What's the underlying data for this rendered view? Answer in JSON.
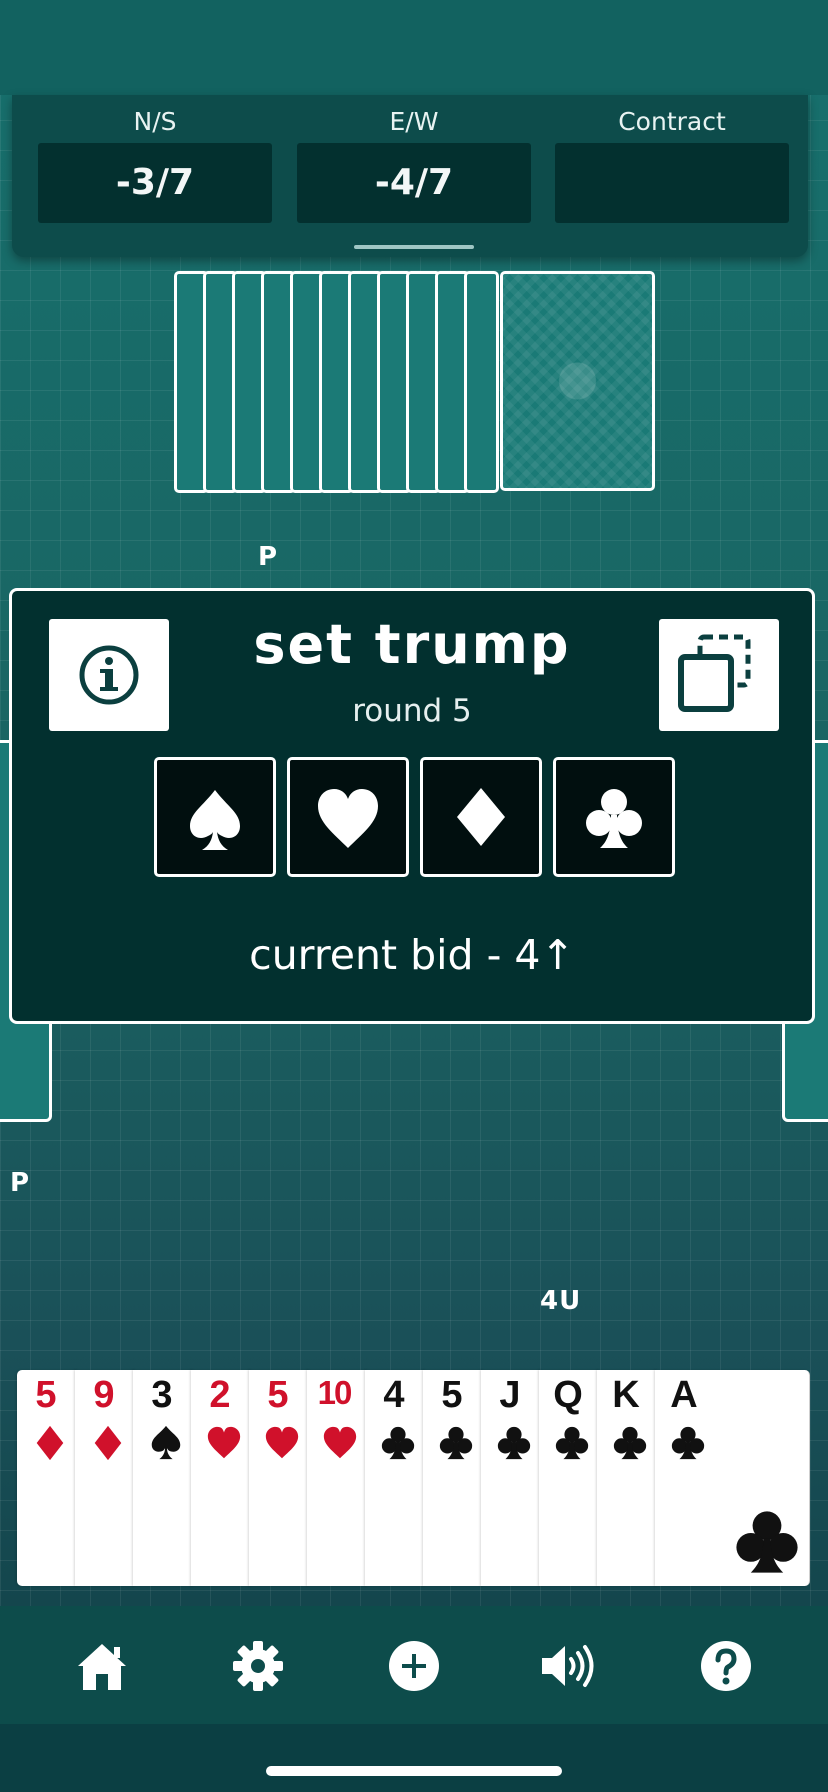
{
  "scoreboard": {
    "ns_label": "N/S",
    "ns_value": "-3/7",
    "ew_label": "E/W",
    "ew_value": "-4/7",
    "contract_label": "Contract",
    "contract_value": ""
  },
  "bid_markers": {
    "north": "P",
    "west": "P",
    "south": "4U"
  },
  "dialog": {
    "title": "set trump",
    "subtitle": "round 5",
    "current_bid": "current bid - 4↑",
    "info_icon": "info-icon",
    "copy_icon": "copy-icon",
    "suits": [
      "spade",
      "heart",
      "diamond",
      "club"
    ]
  },
  "hand": [
    {
      "rank": "5",
      "suit": "diamond",
      "color": "#d0112b"
    },
    {
      "rank": "9",
      "suit": "diamond",
      "color": "#d0112b"
    },
    {
      "rank": "3",
      "suit": "spade",
      "color": "#111111"
    },
    {
      "rank": "2",
      "suit": "heart",
      "color": "#d0112b"
    },
    {
      "rank": "5",
      "suit": "heart",
      "color": "#d0112b"
    },
    {
      "rank": "10",
      "suit": "heart",
      "color": "#d0112b"
    },
    {
      "rank": "4",
      "suit": "club",
      "color": "#111111"
    },
    {
      "rank": "5",
      "suit": "club",
      "color": "#111111"
    },
    {
      "rank": "J",
      "suit": "club",
      "color": "#111111"
    },
    {
      "rank": "Q",
      "suit": "club",
      "color": "#111111"
    },
    {
      "rank": "K",
      "suit": "club",
      "color": "#111111"
    },
    {
      "rank": "A",
      "suit": "club",
      "color": "#111111"
    }
  ],
  "nav": {
    "items": [
      "home-icon",
      "settings-icon",
      "add-icon",
      "sound-icon",
      "help-icon"
    ]
  },
  "colors": {
    "table": "#176563",
    "panel": "#0d4c4b",
    "dialog": "#02302f",
    "red_suit": "#d0112b"
  }
}
